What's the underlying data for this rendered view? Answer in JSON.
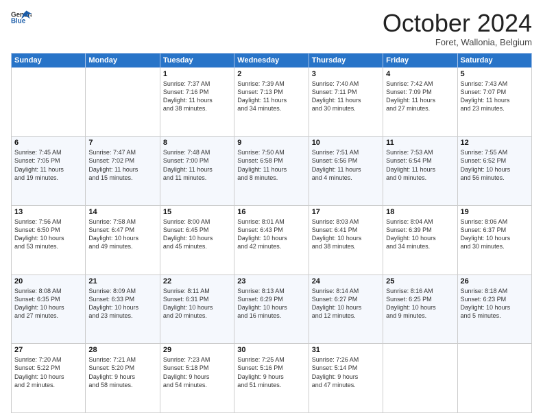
{
  "header": {
    "logo_line1": "General",
    "logo_line2": "Blue",
    "month": "October 2024",
    "location": "Foret, Wallonia, Belgium"
  },
  "days_of_week": [
    "Sunday",
    "Monday",
    "Tuesday",
    "Wednesday",
    "Thursday",
    "Friday",
    "Saturday"
  ],
  "weeks": [
    [
      {
        "day": "",
        "info": ""
      },
      {
        "day": "",
        "info": ""
      },
      {
        "day": "1",
        "info": "Sunrise: 7:37 AM\nSunset: 7:16 PM\nDaylight: 11 hours\nand 38 minutes."
      },
      {
        "day": "2",
        "info": "Sunrise: 7:39 AM\nSunset: 7:13 PM\nDaylight: 11 hours\nand 34 minutes."
      },
      {
        "day": "3",
        "info": "Sunrise: 7:40 AM\nSunset: 7:11 PM\nDaylight: 11 hours\nand 30 minutes."
      },
      {
        "day": "4",
        "info": "Sunrise: 7:42 AM\nSunset: 7:09 PM\nDaylight: 11 hours\nand 27 minutes."
      },
      {
        "day": "5",
        "info": "Sunrise: 7:43 AM\nSunset: 7:07 PM\nDaylight: 11 hours\nand 23 minutes."
      }
    ],
    [
      {
        "day": "6",
        "info": "Sunrise: 7:45 AM\nSunset: 7:05 PM\nDaylight: 11 hours\nand 19 minutes."
      },
      {
        "day": "7",
        "info": "Sunrise: 7:47 AM\nSunset: 7:02 PM\nDaylight: 11 hours\nand 15 minutes."
      },
      {
        "day": "8",
        "info": "Sunrise: 7:48 AM\nSunset: 7:00 PM\nDaylight: 11 hours\nand 11 minutes."
      },
      {
        "day": "9",
        "info": "Sunrise: 7:50 AM\nSunset: 6:58 PM\nDaylight: 11 hours\nand 8 minutes."
      },
      {
        "day": "10",
        "info": "Sunrise: 7:51 AM\nSunset: 6:56 PM\nDaylight: 11 hours\nand 4 minutes."
      },
      {
        "day": "11",
        "info": "Sunrise: 7:53 AM\nSunset: 6:54 PM\nDaylight: 11 hours\nand 0 minutes."
      },
      {
        "day": "12",
        "info": "Sunrise: 7:55 AM\nSunset: 6:52 PM\nDaylight: 10 hours\nand 56 minutes."
      }
    ],
    [
      {
        "day": "13",
        "info": "Sunrise: 7:56 AM\nSunset: 6:50 PM\nDaylight: 10 hours\nand 53 minutes."
      },
      {
        "day": "14",
        "info": "Sunrise: 7:58 AM\nSunset: 6:47 PM\nDaylight: 10 hours\nand 49 minutes."
      },
      {
        "day": "15",
        "info": "Sunrise: 8:00 AM\nSunset: 6:45 PM\nDaylight: 10 hours\nand 45 minutes."
      },
      {
        "day": "16",
        "info": "Sunrise: 8:01 AM\nSunset: 6:43 PM\nDaylight: 10 hours\nand 42 minutes."
      },
      {
        "day": "17",
        "info": "Sunrise: 8:03 AM\nSunset: 6:41 PM\nDaylight: 10 hours\nand 38 minutes."
      },
      {
        "day": "18",
        "info": "Sunrise: 8:04 AM\nSunset: 6:39 PM\nDaylight: 10 hours\nand 34 minutes."
      },
      {
        "day": "19",
        "info": "Sunrise: 8:06 AM\nSunset: 6:37 PM\nDaylight: 10 hours\nand 30 minutes."
      }
    ],
    [
      {
        "day": "20",
        "info": "Sunrise: 8:08 AM\nSunset: 6:35 PM\nDaylight: 10 hours\nand 27 minutes."
      },
      {
        "day": "21",
        "info": "Sunrise: 8:09 AM\nSunset: 6:33 PM\nDaylight: 10 hours\nand 23 minutes."
      },
      {
        "day": "22",
        "info": "Sunrise: 8:11 AM\nSunset: 6:31 PM\nDaylight: 10 hours\nand 20 minutes."
      },
      {
        "day": "23",
        "info": "Sunrise: 8:13 AM\nSunset: 6:29 PM\nDaylight: 10 hours\nand 16 minutes."
      },
      {
        "day": "24",
        "info": "Sunrise: 8:14 AM\nSunset: 6:27 PM\nDaylight: 10 hours\nand 12 minutes."
      },
      {
        "day": "25",
        "info": "Sunrise: 8:16 AM\nSunset: 6:25 PM\nDaylight: 10 hours\nand 9 minutes."
      },
      {
        "day": "26",
        "info": "Sunrise: 8:18 AM\nSunset: 6:23 PM\nDaylight: 10 hours\nand 5 minutes."
      }
    ],
    [
      {
        "day": "27",
        "info": "Sunrise: 7:20 AM\nSunset: 5:22 PM\nDaylight: 10 hours\nand 2 minutes."
      },
      {
        "day": "28",
        "info": "Sunrise: 7:21 AM\nSunset: 5:20 PM\nDaylight: 9 hours\nand 58 minutes."
      },
      {
        "day": "29",
        "info": "Sunrise: 7:23 AM\nSunset: 5:18 PM\nDaylight: 9 hours\nand 54 minutes."
      },
      {
        "day": "30",
        "info": "Sunrise: 7:25 AM\nSunset: 5:16 PM\nDaylight: 9 hours\nand 51 minutes."
      },
      {
        "day": "31",
        "info": "Sunrise: 7:26 AM\nSunset: 5:14 PM\nDaylight: 9 hours\nand 47 minutes."
      },
      {
        "day": "",
        "info": ""
      },
      {
        "day": "",
        "info": ""
      }
    ]
  ]
}
